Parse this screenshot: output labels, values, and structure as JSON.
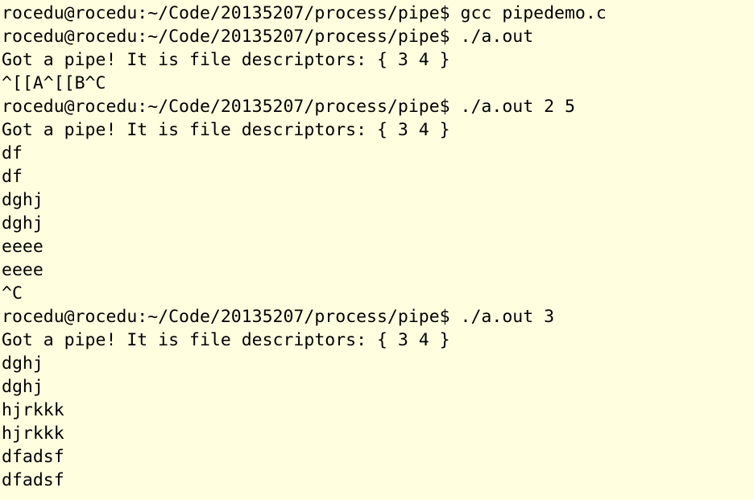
{
  "terminal": {
    "app_name": "xterm",
    "colors": {
      "background": "#ffffe0",
      "foreground": "#000000"
    },
    "prompt": "rocedu@rocedu:~/Code/20135207/process/pipe$",
    "user": "rocedu",
    "host": "rocedu",
    "cwd": "~/Code/20135207/process/pipe",
    "columns": 66,
    "rows": 21,
    "lines": [
      {
        "type": "prompt-command",
        "text": "rocedu@rocedu:~/Code/20135207/process/pipe$ gcc pipedemo.c",
        "command": "gcc pipedemo.c"
      },
      {
        "type": "prompt-command",
        "text": "rocedu@rocedu:~/Code/20135207/process/pipe$ ./a.out",
        "command": "./a.out"
      },
      {
        "type": "output",
        "text": "Got a pipe! It is file descriptors: { 3 4 }"
      },
      {
        "type": "output",
        "text": "^[[A^[[B^C"
      },
      {
        "type": "prompt-command",
        "text": "rocedu@rocedu:~/Code/20135207/process/pipe$ ./a.out 2 5",
        "command": "./a.out 2 5"
      },
      {
        "type": "output",
        "text": "Got a pipe! It is file descriptors: { 3 4 }"
      },
      {
        "type": "output",
        "text": "df"
      },
      {
        "type": "output",
        "text": "df"
      },
      {
        "type": "output",
        "text": "dghj"
      },
      {
        "type": "output",
        "text": "dghj"
      },
      {
        "type": "output",
        "text": "eeee"
      },
      {
        "type": "output",
        "text": "eeee"
      },
      {
        "type": "output",
        "text": "^C"
      },
      {
        "type": "prompt-command",
        "text": "rocedu@rocedu:~/Code/20135207/process/pipe$ ./a.out 3",
        "command": "./a.out 3"
      },
      {
        "type": "output",
        "text": "Got a pipe! It is file descriptors: { 3 4 }"
      },
      {
        "type": "output",
        "text": "dghj"
      },
      {
        "type": "output",
        "text": "dghj"
      },
      {
        "type": "output",
        "text": "hjrkkk"
      },
      {
        "type": "output",
        "text": "hjrkkk"
      },
      {
        "type": "output",
        "text": "dfadsf"
      },
      {
        "type": "output",
        "text": "dfadsf"
      }
    ]
  }
}
